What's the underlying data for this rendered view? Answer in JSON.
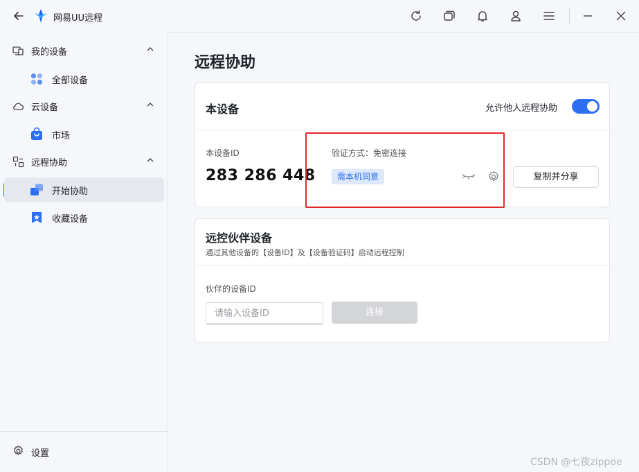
{
  "app": {
    "title": "网易UU远程"
  },
  "sidebar": {
    "groups": [
      {
        "label": "我的设备",
        "items": [
          {
            "label": "全部设备"
          }
        ]
      },
      {
        "label": "云设备",
        "items": [
          {
            "label": "市场"
          }
        ]
      },
      {
        "label": "远程协助",
        "items": [
          {
            "label": "开始协助"
          },
          {
            "label": "收藏设备"
          }
        ]
      }
    ],
    "settings_label": "设置"
  },
  "main": {
    "page_title": "远程协助",
    "this_device": {
      "title": "本设备",
      "allow_label": "允许他人远程协助",
      "allow_enabled": true,
      "device_id_label": "本设备ID",
      "device_id": "283 286 448",
      "auth_label": "验证方式：免密连接",
      "auth_badge": "需本机同意",
      "copy_button": "复制并分享"
    },
    "partner": {
      "title": "远控伙伴设备",
      "subtitle": "通过其他设备的【设备ID】及【设备验证码】启动远程控制",
      "id_label": "伙伴的设备ID",
      "id_placeholder": "请输入设备ID",
      "connect_button": "连接"
    }
  },
  "watermark": "CSDN @七夜zippoe",
  "colors": {
    "accent": "#2c6ff3",
    "highlight": "#e5262b"
  }
}
